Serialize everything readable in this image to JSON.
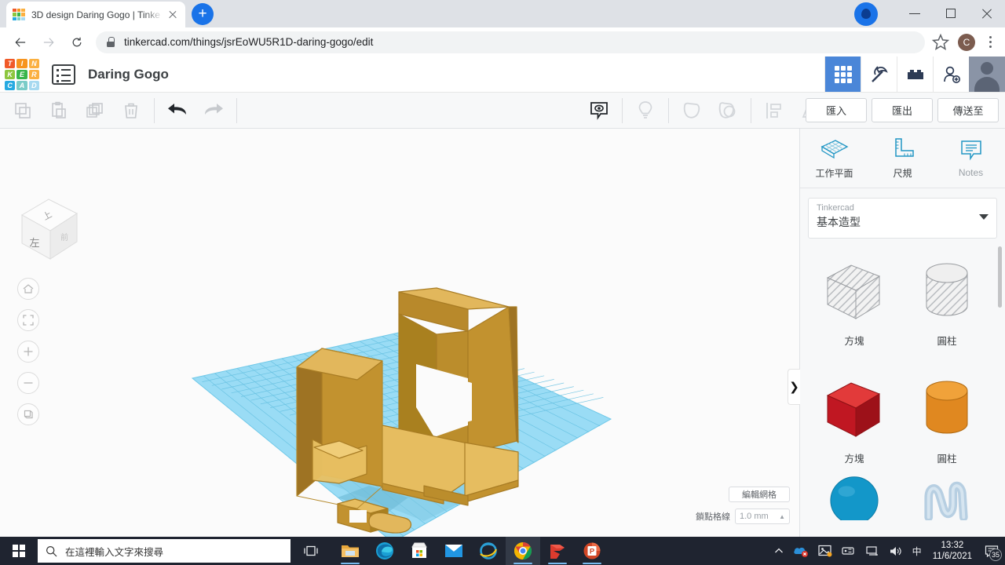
{
  "browser": {
    "tab": {
      "title": "3D design Daring Gogo | Tinke",
      "favicon": "tinkercad-favicon",
      "close_label": "close-tab"
    },
    "new_tab_label": "+",
    "url": "tinkercad.com/things/jsrEoWU5R1D-daring-gogo/edit",
    "profile_initial": "C",
    "window_controls": {
      "minimize": "minimize",
      "maximize": "maximize",
      "close": "close"
    }
  },
  "app": {
    "logo_tiles": [
      {
        "letter": "T",
        "color": "#f05a28"
      },
      {
        "letter": "I",
        "color": "#f7941e"
      },
      {
        "letter": "N",
        "color": "#fbb040"
      },
      {
        "letter": "K",
        "color": "#8dc63f"
      },
      {
        "letter": "E",
        "color": "#39b54a"
      },
      {
        "letter": "R",
        "color": "#fbb040"
      },
      {
        "letter": "C",
        "color": "#27aae1"
      },
      {
        "letter": "A",
        "color": "#7accc8"
      },
      {
        "letter": "D",
        "color": "#a7d9f0"
      }
    ],
    "document_title": "Daring Gogo",
    "header_icons": [
      {
        "name": "grid-icon",
        "active": true
      },
      {
        "name": "pickaxe-icon",
        "active": false
      },
      {
        "name": "brick-icon",
        "active": false
      },
      {
        "name": "add-person-icon",
        "active": false
      }
    ],
    "toolbar": {
      "left_icons": [
        "copy-icon",
        "paste-icon",
        "duplicate-icon",
        "delete-icon"
      ],
      "history_icons": [
        "undo-icon",
        "redo-icon"
      ],
      "center_icons": [
        "note-icon",
        "lightbulb-icon",
        "group-icon",
        "ungroup-icon",
        "align-icon",
        "mirror-icon"
      ],
      "actions": [
        {
          "label": "匯入",
          "name": "import-button"
        },
        {
          "label": "匯出",
          "name": "export-button"
        },
        {
          "label": "傳送至",
          "name": "send-to-button"
        }
      ]
    },
    "canvas": {
      "viewcube_label": "左",
      "nav_buttons": [
        {
          "name": "home-view-button",
          "glyph": "⌂"
        },
        {
          "name": "fit-view-button",
          "glyph": "⛶"
        },
        {
          "name": "zoom-in-button",
          "glyph": "+"
        },
        {
          "name": "zoom-out-button",
          "glyph": "−"
        },
        {
          "name": "ortho-perspective-button",
          "glyph": "▤"
        }
      ],
      "edit_grid_label": "編輯網格",
      "snap_label": "鎖點格線",
      "snap_value": "1.0 mm",
      "model_color": "#c8973a",
      "workplane_color": "#96dcf4",
      "panel_handle": "❯"
    },
    "panel": {
      "tools": [
        {
          "label": "工作平面",
          "name": "workplane-tool",
          "icon": "workplane-icon"
        },
        {
          "label": "尺規",
          "name": "ruler-tool",
          "icon": "ruler-icon"
        },
        {
          "label": "Notes",
          "name": "notes-tool",
          "icon": "notes-icon"
        }
      ],
      "library_source": "Tinkercad",
      "library_name": "基本造型",
      "shapes": [
        {
          "label": "方塊",
          "name": "hole-box-shape",
          "kind": "hole-box"
        },
        {
          "label": "圓柱",
          "name": "hole-cylinder-shape",
          "kind": "hole-cylinder"
        },
        {
          "label": "方塊",
          "name": "red-box-shape",
          "kind": "solid-box",
          "color": "#c8202e"
        },
        {
          "label": "圓柱",
          "name": "orange-cylinder-shape",
          "kind": "solid-cylinder",
          "color": "#e8922e"
        },
        {
          "label": "",
          "name": "blue-sphere-shape",
          "kind": "solid-sphere",
          "color": "#1496c8"
        },
        {
          "label": "",
          "name": "scribble-shape",
          "kind": "scribble",
          "color": "#aecbe0"
        }
      ]
    }
  },
  "taskbar": {
    "start_label": "start-button",
    "search_placeholder": "在這裡輸入文字來搜尋",
    "apps": [
      {
        "name": "file-explorer-icon"
      },
      {
        "name": "edge-icon"
      },
      {
        "name": "microsoft-store-icon"
      },
      {
        "name": "mail-icon"
      },
      {
        "name": "internet-explorer-icon"
      },
      {
        "name": "chrome-icon"
      },
      {
        "name": "sketchup-icon"
      },
      {
        "name": "powerpoint-icon"
      }
    ],
    "ime_label": "中",
    "time": "13:32",
    "date": "11/6/2021",
    "notification_count": "35"
  }
}
